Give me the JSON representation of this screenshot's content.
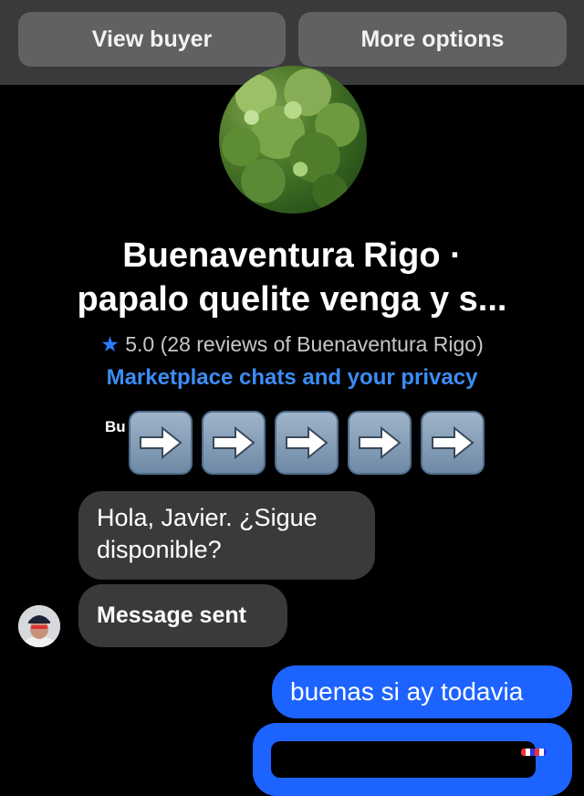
{
  "header": {
    "view_buyer_label": "View buyer",
    "more_options_label": "More options"
  },
  "seller": {
    "name_line1": "Buenaventura Rigo ·",
    "name_line2": "papalo quelite  venga y s...",
    "rating_value": "5.0",
    "reviews_text": "(28 reviews of Buenaventura Rigo)",
    "star_icon": "star-icon"
  },
  "privacy_link": "Marketplace chats and your privacy",
  "partial_text": "Bu",
  "arrow_emoji": {
    "count": 5,
    "icon": "right-arrow-emoji-icon"
  },
  "messages": [
    {
      "direction": "incoming",
      "text": "Hola, Javier. ¿Sigue disponible?"
    },
    {
      "direction": "incoming",
      "text": "Message sent"
    },
    {
      "direction": "outgoing",
      "text": "buenas si ay todavia"
    }
  ],
  "colors": {
    "accent_blue": "#1d63ff",
    "link_blue": "#3b8df5",
    "incoming_bubble": "#3a3a3c",
    "background": "#000000"
  }
}
